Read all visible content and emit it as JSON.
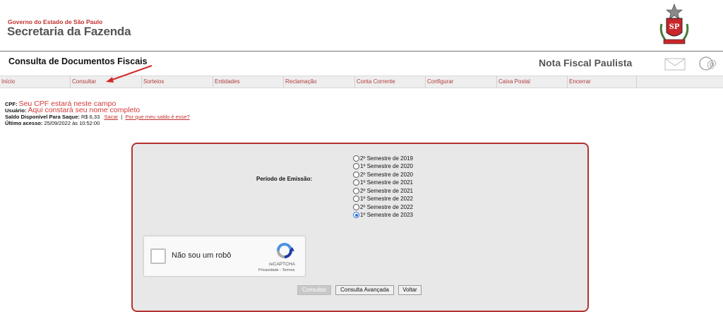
{
  "header": {
    "gov_line": "Governo do Estado de São Paulo",
    "secretaria": "Secretaria da Fazenda",
    "crest_text": "SP",
    "page_title": "Consulta de Documentos Fiscais",
    "brand": "Nota Fiscal Paulista",
    "icons": [
      "mail-icon",
      "at-icon"
    ]
  },
  "nav": {
    "items": [
      {
        "label": "Início"
      },
      {
        "label": "Consultar"
      },
      {
        "label": "Sorteios"
      },
      {
        "label": "Entidades"
      },
      {
        "label": "Reclamação"
      },
      {
        "label": "Conta Corrente"
      },
      {
        "label": "Configurar"
      },
      {
        "label": "Caixa Postal"
      },
      {
        "label": "Encerrar"
      }
    ]
  },
  "user_info": {
    "cpf_label": "CPF:",
    "cpf_value": "Seu CPF estará neste campo",
    "usuario_label": "Usuário:",
    "usuario_value": "Aqui constará seu nome completo",
    "saldo_label": "Saldo Disponível Para Saque:",
    "saldo_value": "R$ 6,33",
    "sacar_link": "Sacar",
    "separator": "|",
    "why_link": "Por que meu saldo é esse?",
    "ultimo_label": "Último acesso:",
    "ultimo_value": "25/09/2022 às 10:52:00"
  },
  "form": {
    "periodo_label": "Período de Emissão:",
    "periods": [
      {
        "label": "2º Semestre de 2019",
        "selected": false
      },
      {
        "label": "1º Semestre de 2020",
        "selected": false
      },
      {
        "label": "2º Semestre de 2020",
        "selected": false
      },
      {
        "label": "1º Semestre de 2021",
        "selected": false
      },
      {
        "label": "2º Semestre de 2021",
        "selected": false
      },
      {
        "label": "1º Semestre de 2022",
        "selected": false
      },
      {
        "label": "2º Semestre de 2022",
        "selected": false
      },
      {
        "label": "1º Semestre de 2023",
        "selected": true
      }
    ],
    "captcha": {
      "label": "Não sou um robô",
      "brand": "reCAPTCHA",
      "links": "Privacidade - Termos"
    },
    "buttons": {
      "consultar": "Consultar",
      "avancada": "Consulta Avançada",
      "voltar": "Voltar"
    }
  },
  "colors": {
    "accent_red": "#c0302d",
    "panel_border": "#b53232",
    "panel_bg": "#e8e8e8",
    "nav_bg": "#eeeeee"
  }
}
